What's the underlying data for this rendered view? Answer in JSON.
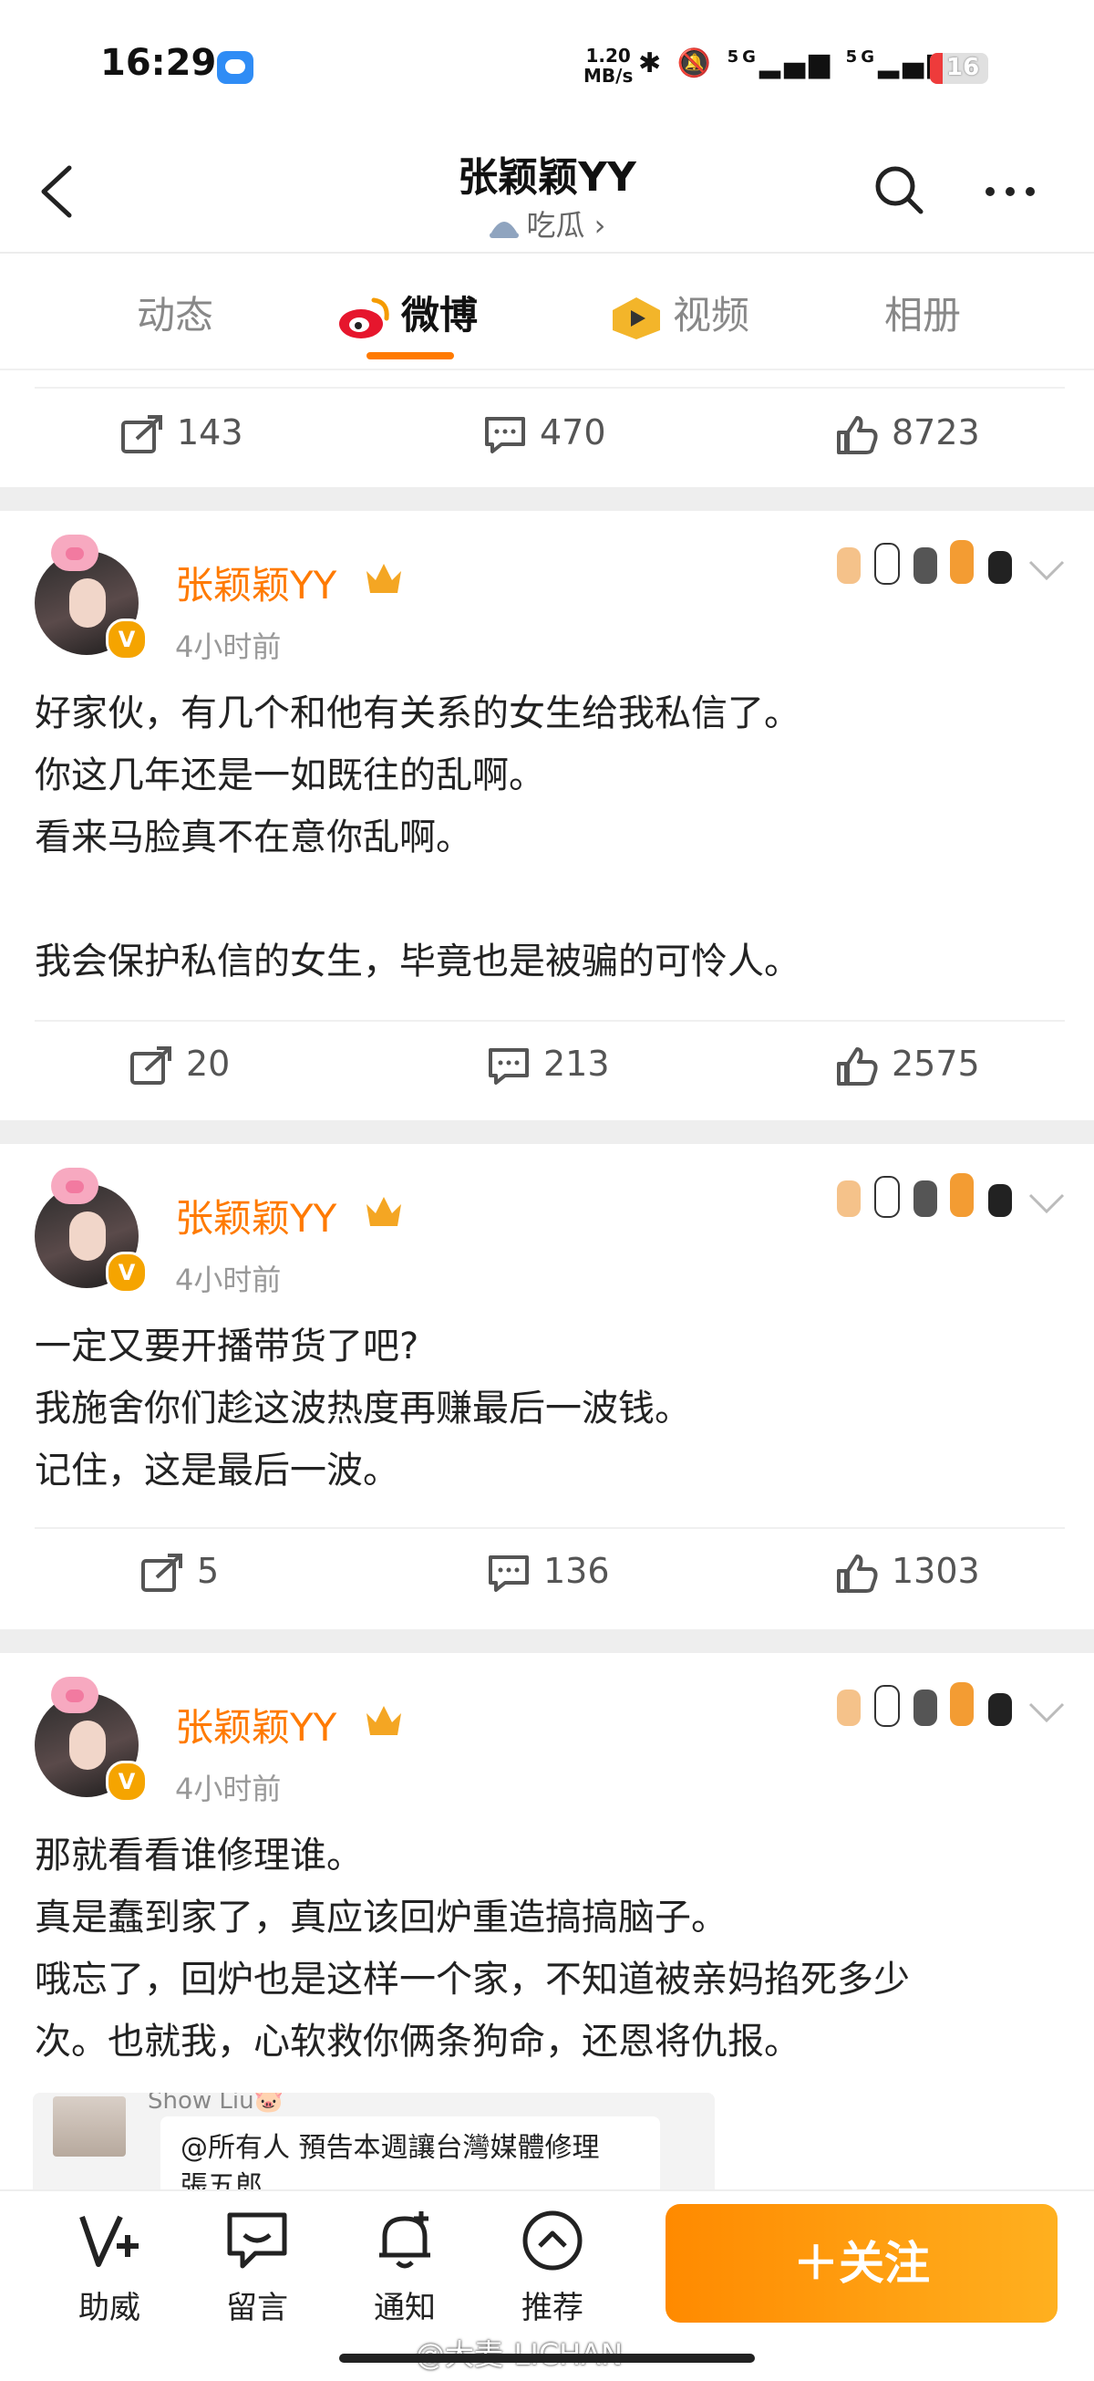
{
  "status_bar": {
    "time": "16:29",
    "net_speed_value": "1.20",
    "net_speed_unit": "MB/s",
    "signal_1": "5G",
    "signal_2": "5G",
    "battery": "16",
    "icons": [
      "message-icon",
      "bluetooth-icon",
      "mute-icon",
      "signal-icon",
      "wifi-icon",
      "battery-icon"
    ]
  },
  "header": {
    "title": "张颖颖YY",
    "subtitle": "吃瓜 ›"
  },
  "tabs": [
    {
      "label": "动态",
      "active": false
    },
    {
      "label": "微博",
      "active": true
    },
    {
      "label": "视频",
      "active": false
    },
    {
      "label": "相册",
      "active": false
    }
  ],
  "top_actions": {
    "repost": "143",
    "comment": "470",
    "like": "8723"
  },
  "posts": [
    {
      "author": "张颖颖YY",
      "time": "4小时前",
      "lines": [
        "好家伙，有几个和他有关系的女生给我私信了。",
        "你这几年还是一如既往的乱啊。",
        "看来马脸真不在意你乱啊。",
        "",
        "我会保护私信的女生，毕竟也是被骗的可怜人。"
      ],
      "repost": "20",
      "comment": "213",
      "like": "2575"
    },
    {
      "author": "张颖颖YY",
      "time": "4小时前",
      "lines": [
        "一定又要开播带货了吧?",
        "我施舍你们趁这波热度再赚最后一波钱。",
        "记住，这是最后一波。"
      ],
      "repost": "5",
      "comment": "136",
      "like": "1303"
    },
    {
      "author": "张颖颖YY",
      "time": "4小时前",
      "lines": [
        "那就看看谁修理谁。",
        "真是蠢到家了，真应该回炉重造搞搞脑子。",
        "哦忘了，回炉也是这样一个家，不知道被亲妈掐死多少",
        "次。也就我，心软救你俩条狗命，还恩将仇报。"
      ],
      "quote": {
        "user": "Show Liu🐷",
        "text_1": "@所有人  預告本週讓台灣媒體修理",
        "text_2": "張五郎"
      }
    }
  ],
  "bottom_nav": [
    {
      "label": "助威",
      "icon": "cheer-icon"
    },
    {
      "label": "留言",
      "icon": "message-board-icon"
    },
    {
      "label": "通知",
      "icon": "bell-plus-icon"
    },
    {
      "label": "推荐",
      "icon": "recommend-icon"
    }
  ],
  "follow_button": "＋关注",
  "watermark": "@大麦-LICHAN",
  "colors": {
    "accent": "#ff7a00",
    "name": "#ff7a00",
    "badge": "#f5a400"
  }
}
